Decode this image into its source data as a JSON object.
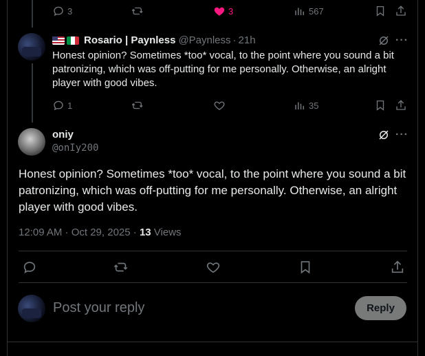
{
  "top_actions": {
    "replies": "3",
    "likes": "3",
    "views": "567"
  },
  "reply": {
    "author_name": "Rosario | Paynless",
    "handle": "@Paynless",
    "separator": "·",
    "time": "21h",
    "text": "Honest opinion? Sometimes *too* vocal, to the point where you sound a bit patronizing, which was off-putting for me personally. Otherwise, an alright player with good vibes.",
    "actions": {
      "replies": "1",
      "views": "35"
    }
  },
  "main_post": {
    "author_name": "oniy",
    "handle": "@onIy200",
    "text": "Honest opinion? Sometimes *too* vocal, to the point where you sound a bit patronizing, which was off-putting for me personally. Otherwise, an alright player with good vibes.",
    "timestamp": "12:09 AM · Oct 29, 2025 · ",
    "views_count": "13",
    "views_label": " Views"
  },
  "composer": {
    "placeholder": "Post your reply",
    "button_label": "Reply"
  },
  "colors": {
    "like_active": "#f91880",
    "text": "#e7e9ea",
    "muted": "#71767b",
    "border": "#2f3336"
  }
}
